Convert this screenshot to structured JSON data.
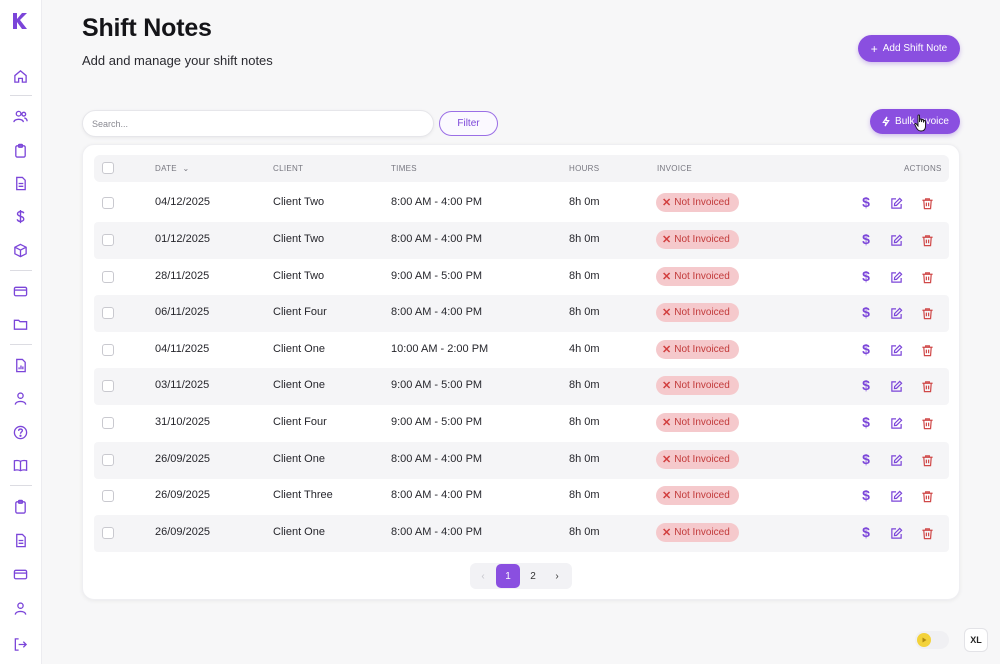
{
  "header": {
    "title": "Shift Notes",
    "subtitle": "Add and manage your shift notes",
    "add_button": "Add Shift Note"
  },
  "toolbar": {
    "search_placeholder": "Search...",
    "filter_label": "Filter",
    "bulk_label": "Bulk Invoice"
  },
  "table": {
    "columns": [
      "DATE",
      "CLIENT",
      "TIMES",
      "HOURS",
      "INVOICE",
      "ACTIONS"
    ],
    "rows": [
      {
        "date": "04/12/2025",
        "client": "Client Two",
        "times": "8:00 AM - 4:00 PM",
        "hours": "8h 0m",
        "invoice": "Not Invoiced"
      },
      {
        "date": "01/12/2025",
        "client": "Client Two",
        "times": "8:00 AM - 4:00 PM",
        "hours": "8h 0m",
        "invoice": "Not Invoiced"
      },
      {
        "date": "28/11/2025",
        "client": "Client Two",
        "times": "9:00 AM - 5:00 PM",
        "hours": "8h 0m",
        "invoice": "Not Invoiced"
      },
      {
        "date": "06/11/2025",
        "client": "Client Four",
        "times": "8:00 AM - 4:00 PM",
        "hours": "8h 0m",
        "invoice": "Not Invoiced"
      },
      {
        "date": "04/11/2025",
        "client": "Client One",
        "times": "10:00 AM - 2:00 PM",
        "hours": "4h 0m",
        "invoice": "Not Invoiced"
      },
      {
        "date": "03/11/2025",
        "client": "Client One",
        "times": "9:00 AM - 5:00 PM",
        "hours": "8h 0m",
        "invoice": "Not Invoiced"
      },
      {
        "date": "31/10/2025",
        "client": "Client Four",
        "times": "9:00 AM - 5:00 PM",
        "hours": "8h 0m",
        "invoice": "Not Invoiced"
      },
      {
        "date": "26/09/2025",
        "client": "Client One",
        "times": "8:00 AM - 4:00 PM",
        "hours": "8h 0m",
        "invoice": "Not Invoiced"
      },
      {
        "date": "26/09/2025",
        "client": "Client Three",
        "times": "8:00 AM - 4:00 PM",
        "hours": "8h 0m",
        "invoice": "Not Invoiced"
      },
      {
        "date": "26/09/2025",
        "client": "Client One",
        "times": "8:00 AM - 4:00 PM",
        "hours": "8h 0m",
        "invoice": "Not Invoiced"
      }
    ]
  },
  "pagination": {
    "prev": "‹",
    "pages": [
      "1",
      "2"
    ],
    "current": "1",
    "next": "›"
  },
  "footer": {
    "size_label": "XL"
  },
  "sidebar": {
    "logo": "k-logo",
    "icons": [
      "home-icon",
      "users-icon",
      "clipboard-icon",
      "document-icon",
      "dollar-icon",
      "cube-icon",
      "card-icon",
      "folder-icon",
      "report-icon",
      "person-icon",
      "help-icon",
      "book-icon",
      "clipboard-icon",
      "document-icon",
      "card-icon",
      "person-icon",
      "logout-icon"
    ]
  },
  "colors": {
    "accent": "#8a4fe0",
    "badge_bg": "#f5c9cc",
    "badge_text": "#c23a3a",
    "danger": "#d04848"
  }
}
